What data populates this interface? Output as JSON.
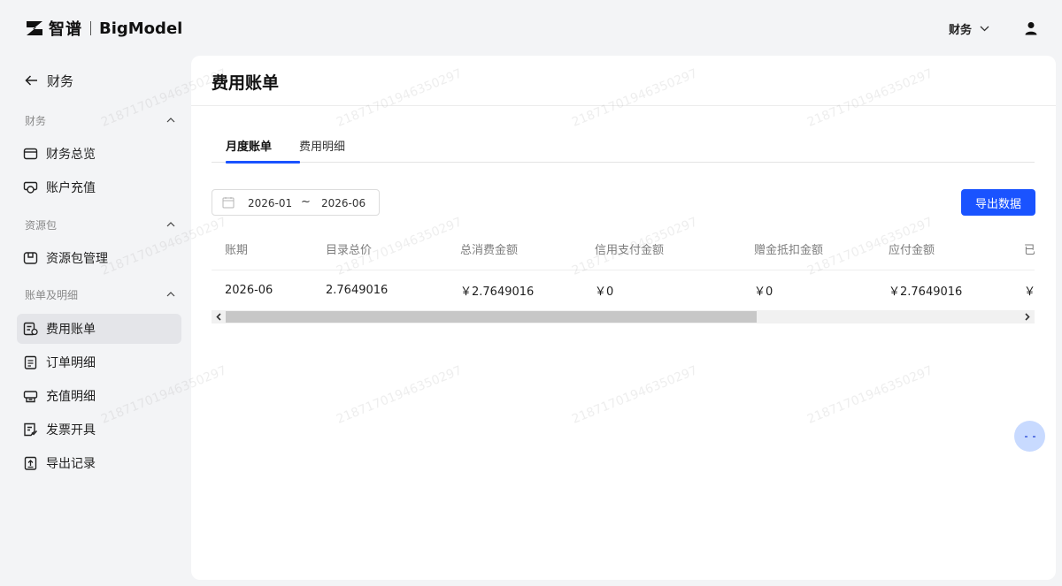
{
  "brand": {
    "logo_cn": "智谱",
    "logo_en": "BigModel",
    "accent": "#1a53ff"
  },
  "header": {
    "finance_menu": "财务"
  },
  "sidebar": {
    "back_label": "财务",
    "groups": [
      {
        "title": "财务",
        "items": [
          {
            "label": "财务总览",
            "icon": "wallet-icon"
          },
          {
            "label": "账户充值",
            "icon": "recharge-icon"
          }
        ]
      },
      {
        "title": "资源包",
        "items": [
          {
            "label": "资源包管理",
            "icon": "package-icon"
          }
        ]
      },
      {
        "title": "账单及明细",
        "items": [
          {
            "label": "费用账单",
            "icon": "bill-icon",
            "active": true
          },
          {
            "label": "订单明细",
            "icon": "order-icon"
          },
          {
            "label": "充值明细",
            "icon": "recharge-detail-icon"
          },
          {
            "label": "发票开具",
            "icon": "invoice-icon"
          },
          {
            "label": "导出记录",
            "icon": "export-icon"
          }
        ]
      }
    ]
  },
  "main": {
    "title": "费用账单",
    "tabs": [
      {
        "label": "月度账单",
        "active": true
      },
      {
        "label": "费用明细",
        "active": false
      }
    ],
    "date_range": {
      "start": "2026-01",
      "separator": "~",
      "end": "2026-06"
    },
    "export_label": "导出数据",
    "table": {
      "headers": [
        "账期",
        "目录总价",
        "总消费金额",
        "信用支付金额",
        "赠金抵扣金额",
        "应付金额",
        "已"
      ],
      "rows": [
        [
          "2026-06",
          "2.7649016",
          "￥2.7649016",
          "￥0",
          "￥0",
          "￥2.7649016",
          "￥"
        ]
      ]
    }
  },
  "watermark": "218717019463502​97"
}
